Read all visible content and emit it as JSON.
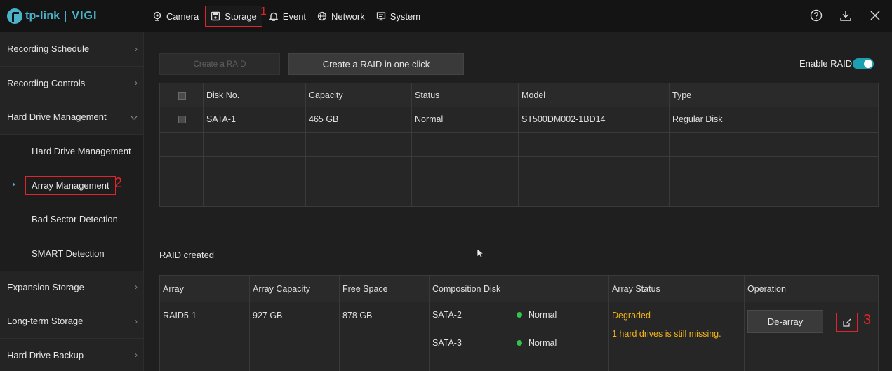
{
  "brand": {
    "logo_text": "tp-link",
    "product": "VIGI",
    "accent": "#4ab3c9"
  },
  "nav": {
    "items": [
      {
        "label": "Camera",
        "icon": "camera-icon"
      },
      {
        "label": "Storage",
        "icon": "save-icon",
        "active": true
      },
      {
        "label": "Event",
        "icon": "bell-icon"
      },
      {
        "label": "Network",
        "icon": "globe-icon"
      },
      {
        "label": "System",
        "icon": "monitor-icon"
      }
    ],
    "markers": {
      "one": "1"
    }
  },
  "top_actions": [
    "help-icon",
    "download-icon",
    "close-icon"
  ],
  "sidebar": {
    "items": [
      {
        "label": "Recording Schedule"
      },
      {
        "label": "Recording Controls"
      },
      {
        "label": "Hard Drive Management",
        "expanded": true
      },
      {
        "label": "Hard Drive Management",
        "sub": true
      },
      {
        "label": "Array Management",
        "sub": true,
        "active": true
      },
      {
        "label": "Bad Sector Detection",
        "sub": true
      },
      {
        "label": "SMART Detection",
        "sub": true
      },
      {
        "label": "Expansion Storage"
      },
      {
        "label": "Long-term Storage"
      },
      {
        "label": "Hard Drive Backup"
      }
    ],
    "marker": "2"
  },
  "main": {
    "create_raid": "Create a RAID",
    "create_raid_one_click": "Create a RAID in one click",
    "enable_raid_label": "Enable RAID",
    "enable_raid": true,
    "disk_table": {
      "headers": [
        "",
        "Disk No.",
        "Capacity",
        "Status",
        "Model",
        "Type"
      ],
      "rows": [
        [
          "SATA-1",
          "465 GB",
          "Normal",
          "ST500DM002-1BD14",
          "Regular Disk"
        ]
      ]
    },
    "raid_created_label": "RAID created",
    "raid_table": {
      "headers": [
        "Array",
        "Array Capacity",
        "Free Space",
        "Composition Disk",
        "Array Status",
        "Operation"
      ],
      "row": {
        "array": "RAID5-1",
        "capacity": "927 GB",
        "free": "878 GB",
        "disks": [
          {
            "name": "SATA-2",
            "status": "Normal"
          },
          {
            "name": "SATA-3",
            "status": "Normal"
          }
        ],
        "status": "Degraded",
        "status_detail": "1 hard drives is still missing.",
        "de_array": "De-array",
        "marker": "3"
      }
    }
  },
  "colors": {
    "status_ok": "#33c24d",
    "warning": "#f2b218",
    "highlight": "#e0242b",
    "toggle_on": "#1aa0b0"
  }
}
